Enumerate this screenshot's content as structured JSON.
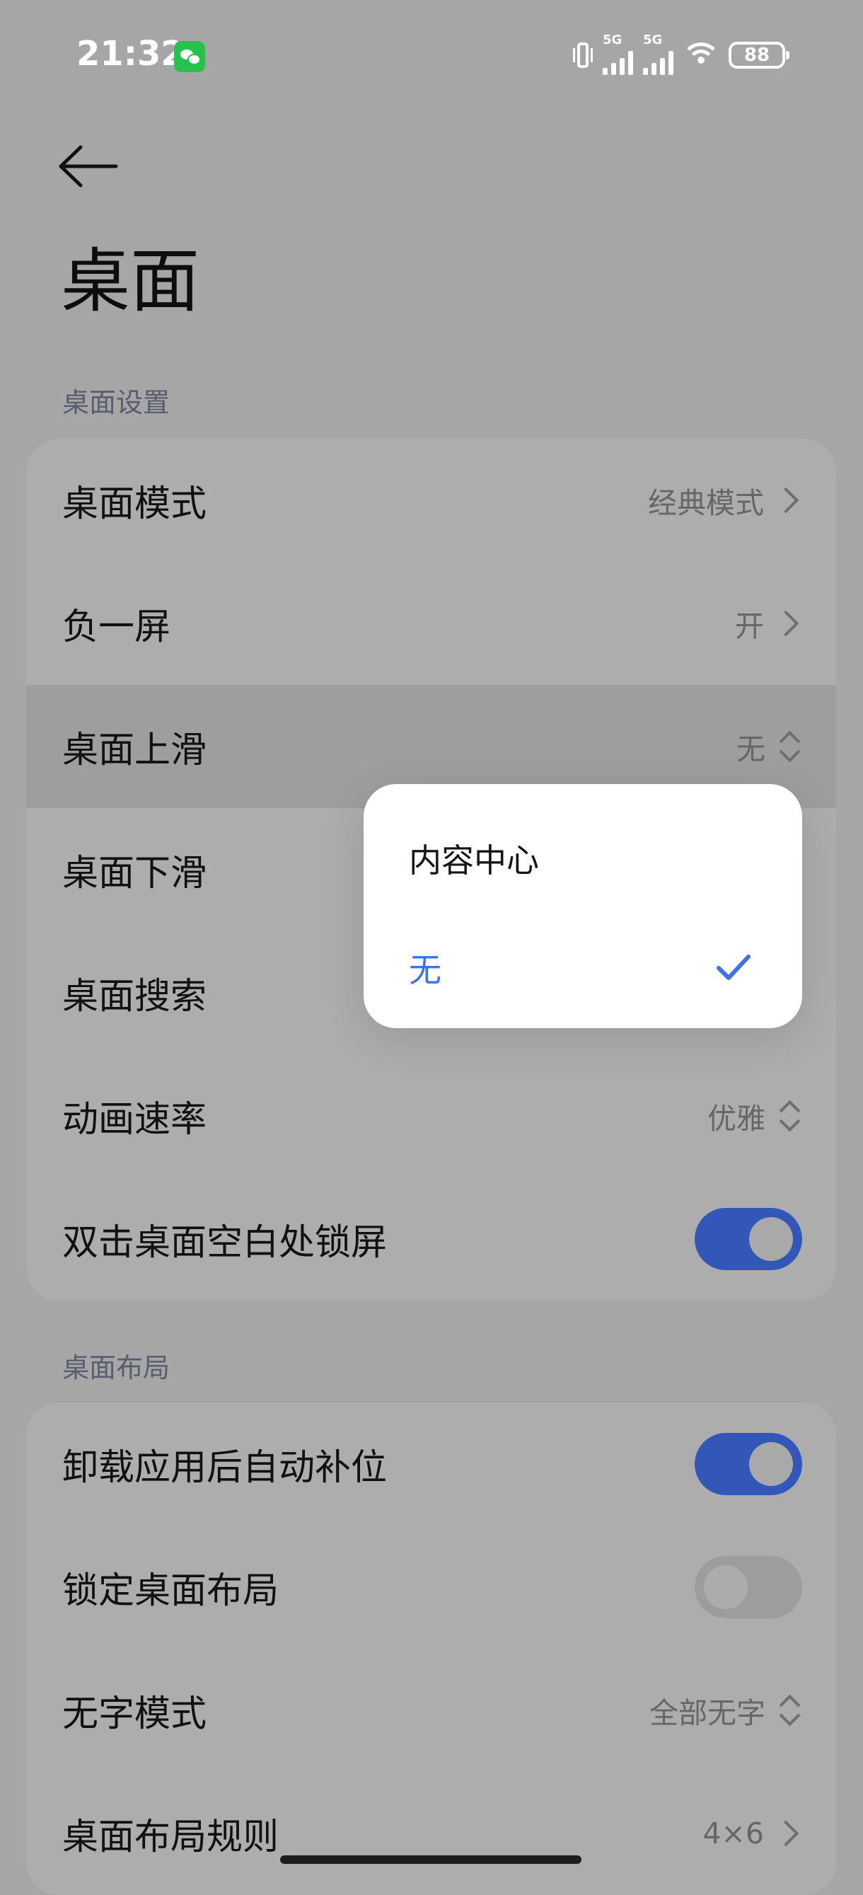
{
  "status_bar": {
    "time": "21:32",
    "network_1": "5G",
    "network_2": "5G",
    "battery": "88",
    "icons": [
      "wechat-icon",
      "vibrate-icon",
      "signal-icon",
      "signal-icon",
      "wifi-icon",
      "battery-icon"
    ]
  },
  "header": {
    "back_icon": "back-arrow-icon",
    "title": "桌面"
  },
  "sections": {
    "desktop_settings": {
      "label": "桌面设置",
      "rows": {
        "desktop_mode": {
          "label": "桌面模式",
          "value": "经典模式"
        },
        "minus_one_screen": {
          "label": "负一屏",
          "value": "开"
        },
        "swipe_up": {
          "label": "桌面上滑",
          "value": "无"
        },
        "swipe_down": {
          "label": "桌面下滑"
        },
        "search": {
          "label": "桌面搜索"
        },
        "animation_speed": {
          "label": "动画速率",
          "value": "优雅"
        },
        "double_tap_lock": {
          "label": "双击桌面空白处锁屏",
          "toggle_on": true
        }
      }
    },
    "desktop_layout": {
      "label": "桌面布局",
      "rows": {
        "auto_fill": {
          "label": "卸载应用后自动补位",
          "toggle_on": true
        },
        "lock_layout": {
          "label": "锁定桌面布局",
          "toggle_on": false
        },
        "no_text_mode": {
          "label": "无字模式",
          "value": "全部无字"
        },
        "layout_rule": {
          "label": "桌面布局规则",
          "value": "4×6"
        }
      }
    }
  },
  "popup": {
    "options": [
      {
        "label": "内容中心",
        "selected": false
      },
      {
        "label": "无",
        "selected": true
      }
    ],
    "check_icon": "check-icon"
  },
  "colors": {
    "background_dimmed": "#a6a6a6",
    "toggle_on": "#3257b8",
    "selected_option": "#3c72e6",
    "section_label": "#595d6e"
  }
}
